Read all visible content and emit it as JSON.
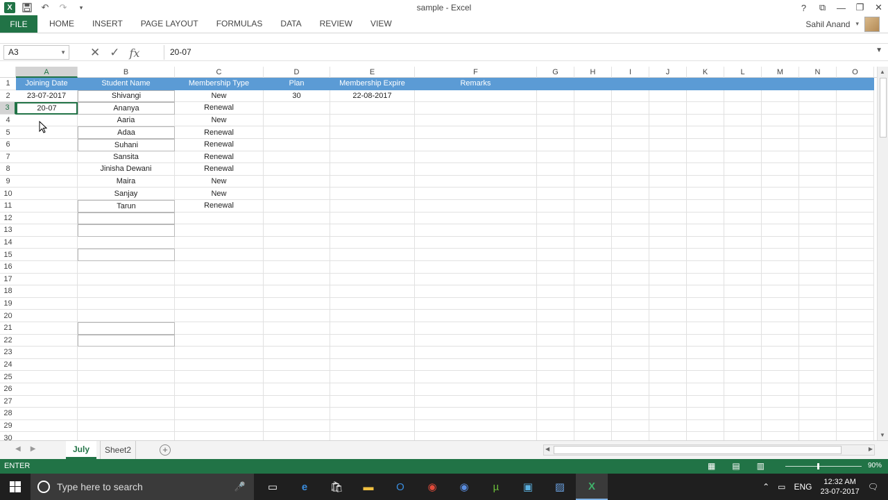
{
  "titlebar": {
    "title": "sample - Excel",
    "app_icon": "X",
    "qat_icons": [
      "save-icon",
      "undo-icon",
      "redo-icon",
      "customize-icon"
    ],
    "help": "?",
    "restore_ribbon": "⧉",
    "minimize": "—",
    "maximize": "❐",
    "close": "✕"
  },
  "ribbon": {
    "file_tab": "FILE",
    "tabs": [
      "HOME",
      "INSERT",
      "PAGE LAYOUT",
      "FORMULAS",
      "DATA",
      "REVIEW",
      "VIEW"
    ],
    "user_name": "Sahil Anand",
    "user_dropdown": "▾"
  },
  "formula_bar": {
    "name_box": "A3",
    "cancel_glyph": "✕",
    "enter_glyph": "✓",
    "fx_glyph": "fx",
    "content": "20-07"
  },
  "sheet": {
    "columns": [
      "A",
      "B",
      "C",
      "D",
      "E",
      "F",
      "G",
      "H",
      "I",
      "J",
      "K",
      "L",
      "M",
      "N",
      "O"
    ],
    "row_numbers": [
      "1",
      "2",
      "3",
      "4",
      "5",
      "6",
      "7",
      "8",
      "9",
      "10",
      "11",
      "12",
      "13",
      "14",
      "15",
      "16",
      "17",
      "18",
      "19",
      "20",
      "21",
      "22",
      "23",
      "24",
      "25",
      "26",
      "27",
      "28",
      "29",
      "30"
    ],
    "header_row": [
      "Joining Date",
      "Student Name",
      "Membership Type",
      "Plan",
      "Membership Expire",
      "Remarks"
    ],
    "data_rows": [
      [
        "23-07-2017",
        "Shivangi",
        "New",
        "30",
        "22-08-2017",
        ""
      ],
      [
        "20-07",
        "Ananya",
        "Renewal",
        "",
        "",
        ""
      ],
      [
        "",
        "Aaria",
        "New",
        "",
        "",
        ""
      ],
      [
        "",
        "Adaa",
        "Renewal",
        "",
        "",
        ""
      ],
      [
        "",
        "Suhani",
        "Renewal",
        "",
        "",
        ""
      ],
      [
        "",
        "Sansita",
        "Renewal",
        "",
        "",
        ""
      ],
      [
        "",
        "Jinisha Dewani",
        "Renewal",
        "",
        "",
        ""
      ],
      [
        "",
        "Maira",
        "New",
        "",
        "",
        ""
      ],
      [
        "",
        "Sanjay",
        "New",
        "",
        "",
        ""
      ],
      [
        "",
        "Tarun",
        "Renewal",
        "",
        "",
        ""
      ]
    ],
    "active_cell": "A3"
  },
  "sheet_tabs": {
    "tabs": [
      "July",
      "Sheet2"
    ],
    "active": "July",
    "add_glyph": "+"
  },
  "statusbar": {
    "mode": "ENTER",
    "zoom": "90%"
  },
  "taskbar": {
    "search_placeholder": "Type here to search",
    "language": "ENG",
    "time": "12:32 AM",
    "date": "23-07-2017"
  },
  "colors": {
    "excel_green": "#217346",
    "header_blue": "#5b9bd5"
  }
}
